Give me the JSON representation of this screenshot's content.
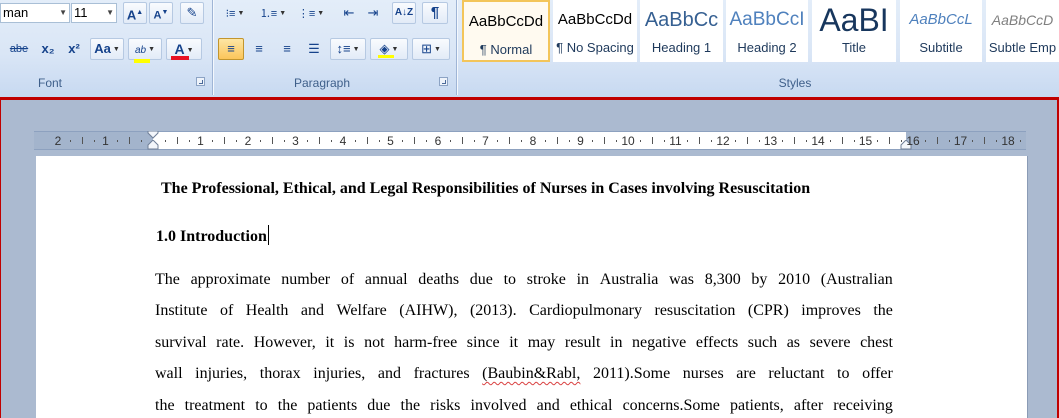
{
  "ribbon": {
    "font_group": {
      "label": "Font",
      "font_name": "man",
      "font_size": "11",
      "grow_glyph": "A",
      "shrink_glyph": "A",
      "clear_glyph": "✎",
      "strike_glyph": "abe",
      "subscript_glyph": "x₂",
      "superscript_glyph": "x²",
      "case_glyph": "Aa",
      "highlight_glyph": "ab",
      "font_color_glyph": "A",
      "highlight_color": "#ffff00",
      "font_color": "#e81123"
    },
    "paragraph_group": {
      "label": "Paragraph",
      "sort_glyph": "A↓Z",
      "pilcrow_glyph": "¶"
    },
    "styles_group": {
      "label": "Styles",
      "items": [
        {
          "sample": "AaBbCcDd",
          "name": "¶ Normal"
        },
        {
          "sample": "AaBbCcDd",
          "name": "¶ No Spacing"
        },
        {
          "sample": "AaBbCc",
          "name": "Heading 1"
        },
        {
          "sample": "AaBbCcI",
          "name": "Heading 2"
        },
        {
          "sample": "AaBI",
          "name": "Title"
        },
        {
          "sample": "AaBbCcL",
          "name": "Subtitle"
        },
        {
          "sample": "AaBbCcD",
          "name": "Subtle Emp"
        }
      ]
    }
  },
  "ruler": {
    "numbers": [
      "2",
      "1",
      "1",
      "2",
      "3",
      "4",
      "5",
      "6",
      "7",
      "8",
      "9",
      "10",
      "11",
      "12",
      "13",
      "14",
      "15",
      "16",
      "17",
      "18"
    ]
  },
  "document": {
    "title": "The Professional, Ethical, and Legal Responsibilities of Nurses in Cases involving Resuscitation",
    "heading_number": "1.0",
    "heading_text": "Introduction",
    "paragraph_lines": [
      "The approximate number of annual deaths due to stroke in Australia was 8,300 by 2010 (Australian",
      "Institute of Health and Welfare (AIHW), (2013). Cardiopulmonary resuscitation (CPR) improves the",
      "survival rate. However, it is not harm-free since it may result in negative effects such as severe chest",
      "wall injuries, thorax injuries, and fractures (Baubin&Rabl, 2011).Some nurses are reluctant to offer",
      "the treatment to the patients due the risks involved and ethical concerns.Some patients, after receiving"
    ]
  }
}
